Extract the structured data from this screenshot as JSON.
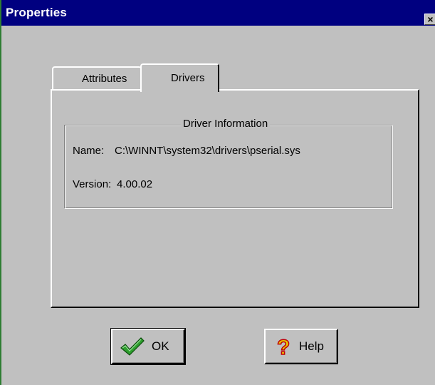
{
  "window": {
    "title": "Properties",
    "close_glyph": "×"
  },
  "tabs": [
    {
      "label": "Attributes",
      "active": false
    },
    {
      "label": "Drivers",
      "active": true
    }
  ],
  "driver_info": {
    "group_title": "Driver Information",
    "name_label": "Name:",
    "name_value": "C:\\WINNT\\system32\\drivers\\pserial.sys",
    "version_label": "Version:",
    "version_value": "4.00.02"
  },
  "buttons": {
    "ok": {
      "label": "OK",
      "icon": "checkmark-icon",
      "icon_color": "#2e9e2e"
    },
    "help": {
      "label": "Help",
      "icon": "question-mark-icon",
      "icon_color": "#e8c800"
    }
  },
  "colors": {
    "titlebar": "#000080",
    "face": "#c0c0c0"
  }
}
